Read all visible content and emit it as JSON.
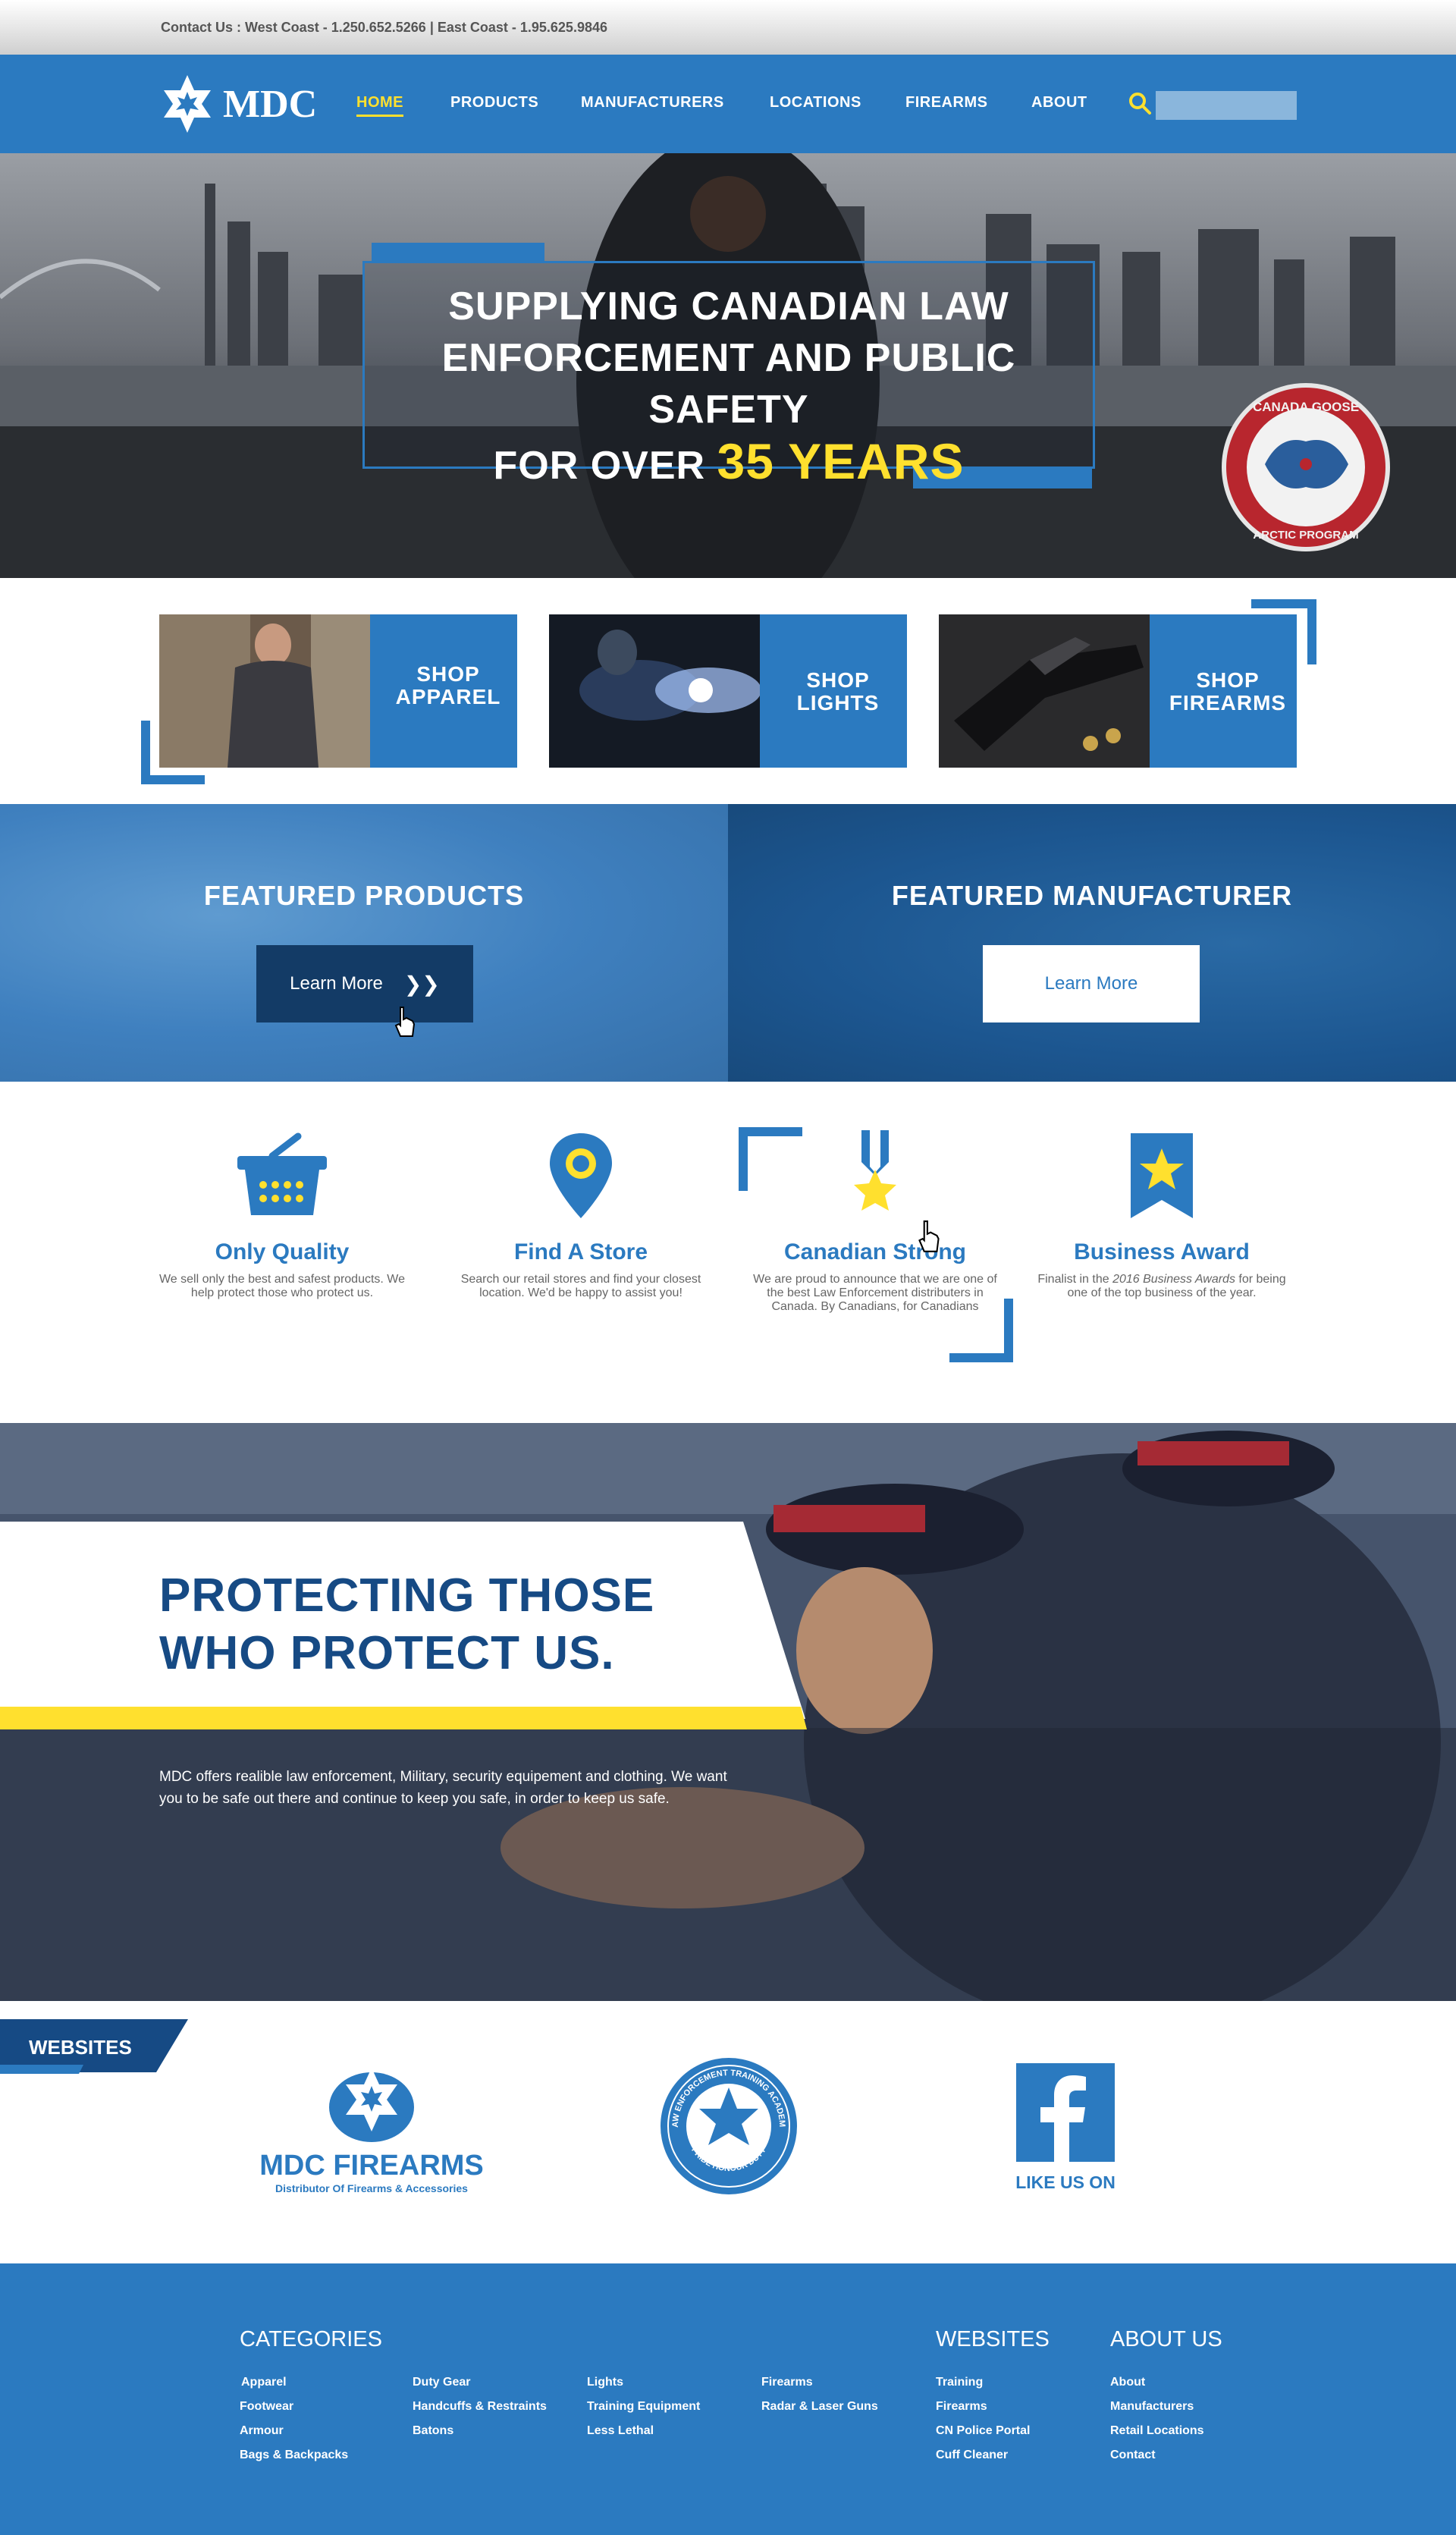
{
  "topbar": {
    "contact": "Contact Us : West Coast - 1.250.652.5266 | East Coast - 1.95.625.9846"
  },
  "nav": {
    "logo_text": "MDC",
    "items": [
      {
        "label": "HOME",
        "active": true
      },
      {
        "label": "PRODUCTS"
      },
      {
        "label": "MANUFACTURERS"
      },
      {
        "label": "LOCATIONS"
      },
      {
        "label": "FIREARMS"
      },
      {
        "label": "ABOUT"
      }
    ],
    "search_placeholder": "",
    "accent_color": "#ffe02e",
    "brand_color": "#2b7ac0"
  },
  "hero": {
    "line1": "SUPPLYING CANADIAN LAW",
    "line2": "ENFORCEMENT AND PUBLIC SAFETY",
    "line3_prefix": "FOR OVER",
    "line3_highlight": "35 YEARS",
    "badge_top": "CANADA GOOSE",
    "badge_bottom": "ARCTIC PROGRAM"
  },
  "shop": [
    {
      "line1": "SHOP",
      "line2": "APPAREL"
    },
    {
      "line1": "SHOP",
      "line2": "LIGHTS"
    },
    {
      "line1": "SHOP",
      "line2": "FIREARMS"
    }
  ],
  "featured": {
    "products_title": "FEATURED PRODUCTS",
    "products_button": "Learn More",
    "manufacturer_title": "FEATURED MANUFACTURER",
    "manufacturer_button": "Learn More"
  },
  "features": [
    {
      "title": "Only Quality",
      "desc": "We sell only the best and safest products. We help protect those who protect us.",
      "icon": "basket-icon"
    },
    {
      "title": "Find A Store",
      "desc": "Search our retail stores and find your closest location. We'd be happy to assist you!",
      "icon": "map-pin-icon"
    },
    {
      "title": "Canadian Strong",
      "desc": "We are proud to announce that we are one of the best Law Enforcement distributers in Canada. By Canadians, for Canadians",
      "icon": "medal-icon"
    },
    {
      "title": "Business Award",
      "desc_prefix": "Finalist in the ",
      "desc_em": "2016 Business Awards",
      "desc_suffix": " for being one of the top business of the year.",
      "icon": "award-ribbon-icon"
    }
  ],
  "protect": {
    "title_line1": "PROTECTING THOSE",
    "title_line2": "WHO PROTECT US.",
    "text": "MDC offers realible law enforcement, Military, security equipement and clothing. We want you to be safe out there and continue to keep you safe, in order to keep us safe."
  },
  "websites": {
    "tab_label": "WEBSITES",
    "firearms_title": "MDC FIREARMS",
    "firearms_sub": "Distributor Of Firearms & Accessories",
    "academy_ring": "LAW ENFORCEMENT TRAINING ACADEMY",
    "academy_bottom": "PRIDE HONOUR DUTY",
    "facebook_caption": "LIKE US ON"
  },
  "footer": {
    "categories_title": "CATEGORIES",
    "categories": [
      [
        "Apparel",
        "Footwear",
        "Armour",
        "Bags & Backpacks"
      ],
      [
        "Duty Gear",
        "Handcuffs & Restraints",
        "Batons"
      ],
      [
        "Lights",
        "Training Equipment",
        "Less Lethal"
      ],
      [
        "Firearms",
        "Radar & Laser Guns"
      ]
    ],
    "websites_title": "WEBSITES",
    "websites": [
      "Training",
      "Firearms",
      "CN Police Portal",
      "Cuff Cleaner"
    ],
    "about_title": "ABOUT US",
    "about": [
      "About",
      "Manufacturers",
      "Retail Locations",
      "Contact"
    ]
  }
}
